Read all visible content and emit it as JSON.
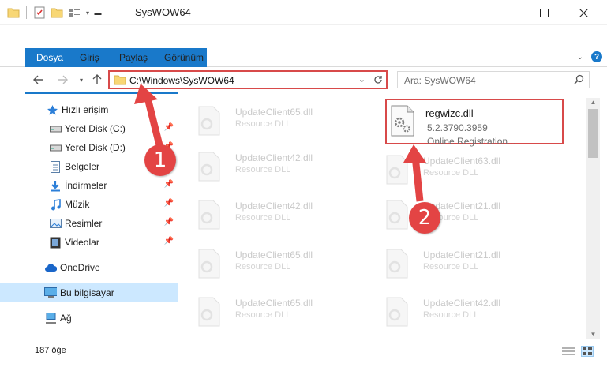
{
  "window": {
    "title": "SysWOW64",
    "minimize": "—",
    "maximize": "☐",
    "close": "✕"
  },
  "ribbon": {
    "tabs": [
      "Dosya",
      "Giriş",
      "Paylaş",
      "Görünüm"
    ],
    "help": "?"
  },
  "nav": {
    "address_path": "C:\\Windows\\SysWOW64",
    "search_placeholder": "Ara: SysWOW64"
  },
  "sidebar": {
    "items": [
      {
        "label": "Hızlı erişim",
        "icon": "star-icon",
        "pinned": false
      },
      {
        "label": "Yerel Disk (C:)",
        "icon": "drive-icon",
        "pinned": true
      },
      {
        "label": "Yerel Disk (D:)",
        "icon": "drive-icon",
        "pinned": true
      },
      {
        "label": "Belgeler",
        "icon": "documents-icon",
        "pinned": true
      },
      {
        "label": "İndirmeler",
        "icon": "download-icon",
        "pinned": true
      },
      {
        "label": "Müzik",
        "icon": "music-icon",
        "pinned": true
      },
      {
        "label": "Resimler",
        "icon": "pictures-icon",
        "pinned": true
      },
      {
        "label": "Videolar",
        "icon": "videos-icon",
        "pinned": true
      },
      {
        "label": "OneDrive",
        "icon": "cloud-icon",
        "pinned": false
      },
      {
        "label": "Bu bilgisayar",
        "icon": "computer-icon",
        "pinned": false,
        "selected": true
      },
      {
        "label": "Ağ",
        "icon": "network-icon",
        "pinned": false
      }
    ]
  },
  "files": {
    "highlighted": {
      "name": "regwizc.dll",
      "version": "5.2.3790.3959",
      "type": "Online Registration..."
    },
    "faded": [
      {
        "name": "UpdateClient65.dll",
        "type": "Resource DLL"
      },
      {
        "name": "UpdateClient42.dll",
        "type": "Resource DLL"
      },
      {
        "name": "UpdateClient63.dll",
        "type": "Resource DLL"
      },
      {
        "name": "UpdateClient42.dll",
        "type": "Resource DLL"
      },
      {
        "name": "UpdateClient21.dll",
        "type": "Resource DLL"
      },
      {
        "name": "UpdateClient65.dll",
        "type": "Resource DLL"
      },
      {
        "name": "UpdateClient21.dll",
        "type": "Resource DLL"
      },
      {
        "name": "UpdateClient65.dll",
        "type": "Resource DLL"
      },
      {
        "name": "UpdateClient42.dll",
        "type": "Resource DLL"
      }
    ]
  },
  "annotations": {
    "step1": "1",
    "step2": "2",
    "color": "#e34444"
  },
  "status": {
    "item_count": "187 öğe"
  },
  "colors": {
    "accent": "#1979ca",
    "highlight_border": "#d84a4a",
    "selected_bg": "#cce8ff"
  }
}
